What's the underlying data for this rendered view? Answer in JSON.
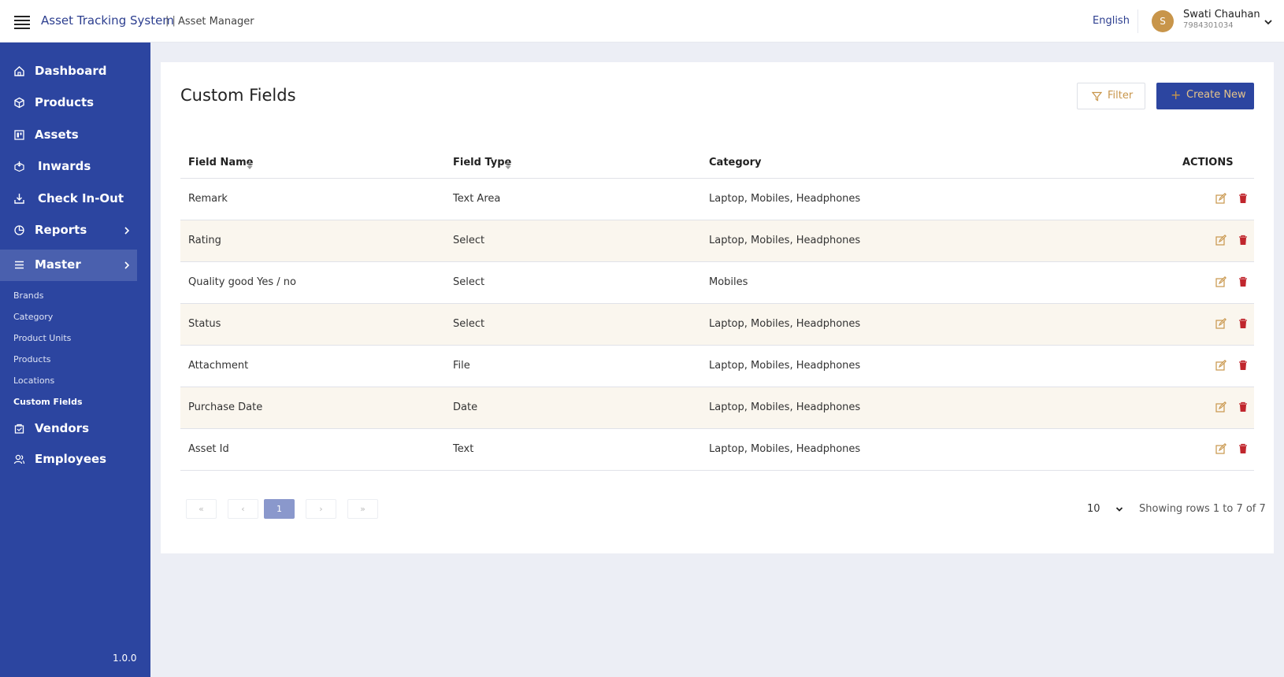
{
  "header": {
    "app_title": "Asset Tracking System",
    "separator": "| |",
    "subtitle": "Asset Manager",
    "language": "English",
    "user": {
      "initial": "S",
      "name": "Swati Chauhan",
      "phone": "7984301034"
    }
  },
  "sidebar": {
    "items": [
      {
        "label": "Dashboard",
        "icon": "home-icon"
      },
      {
        "label": "Products",
        "icon": "box-icon"
      },
      {
        "label": "Assets",
        "icon": "asset-icon"
      },
      {
        "label": "Inwards",
        "icon": "inward-icon"
      },
      {
        "label": "Check In-Out",
        "icon": "checkin-icon"
      },
      {
        "label": "Reports",
        "icon": "pie-chart-icon",
        "has_submenu": true
      },
      {
        "label": "Master",
        "icon": "list-icon",
        "has_submenu": true,
        "active": true
      }
    ],
    "submenu": [
      {
        "label": "Brands"
      },
      {
        "label": "Category"
      },
      {
        "label": "Product Units"
      },
      {
        "label": "Products"
      },
      {
        "label": "Locations"
      },
      {
        "label": "Custom Fields",
        "active": true
      }
    ],
    "bottom_items": [
      {
        "label": "Vendors",
        "icon": "vendor-icon"
      },
      {
        "label": "Employees",
        "icon": "users-icon"
      }
    ],
    "version": "1.0.0"
  },
  "main": {
    "title": "Custom Fields",
    "filter_label": "Filter",
    "create_label": "Create New",
    "columns": [
      "Field Name",
      "Field Type",
      "Category",
      "ACTIONS"
    ],
    "rows": [
      {
        "name": "Remark",
        "type": "Text Area",
        "category": "Laptop, Mobiles, Headphones"
      },
      {
        "name": "Rating",
        "type": "Select",
        "category": "Laptop, Mobiles, Headphones"
      },
      {
        "name": "Quality good Yes / no",
        "type": "Select",
        "category": "Mobiles"
      },
      {
        "name": "Status",
        "type": "Select",
        "category": "Laptop, Mobiles, Headphones"
      },
      {
        "name": "Attachment",
        "type": "File",
        "category": "Laptop, Mobiles, Headphones"
      },
      {
        "name": "Purchase Date",
        "type": "Date",
        "category": "Laptop, Mobiles, Headphones"
      },
      {
        "name": "Asset Id",
        "type": "Text",
        "category": "Laptop, Mobiles, Headphones"
      }
    ],
    "pagination": {
      "first": "«",
      "prev": "‹",
      "current": "1",
      "next": "›",
      "last": "»",
      "per_page": "10",
      "showing": "Showing rows 1 to 7 of 7"
    }
  },
  "colors": {
    "primary": "#2c45a0",
    "accent": "#c8954a",
    "row_alt": "#faf6ee",
    "delete": "#c0262d"
  }
}
